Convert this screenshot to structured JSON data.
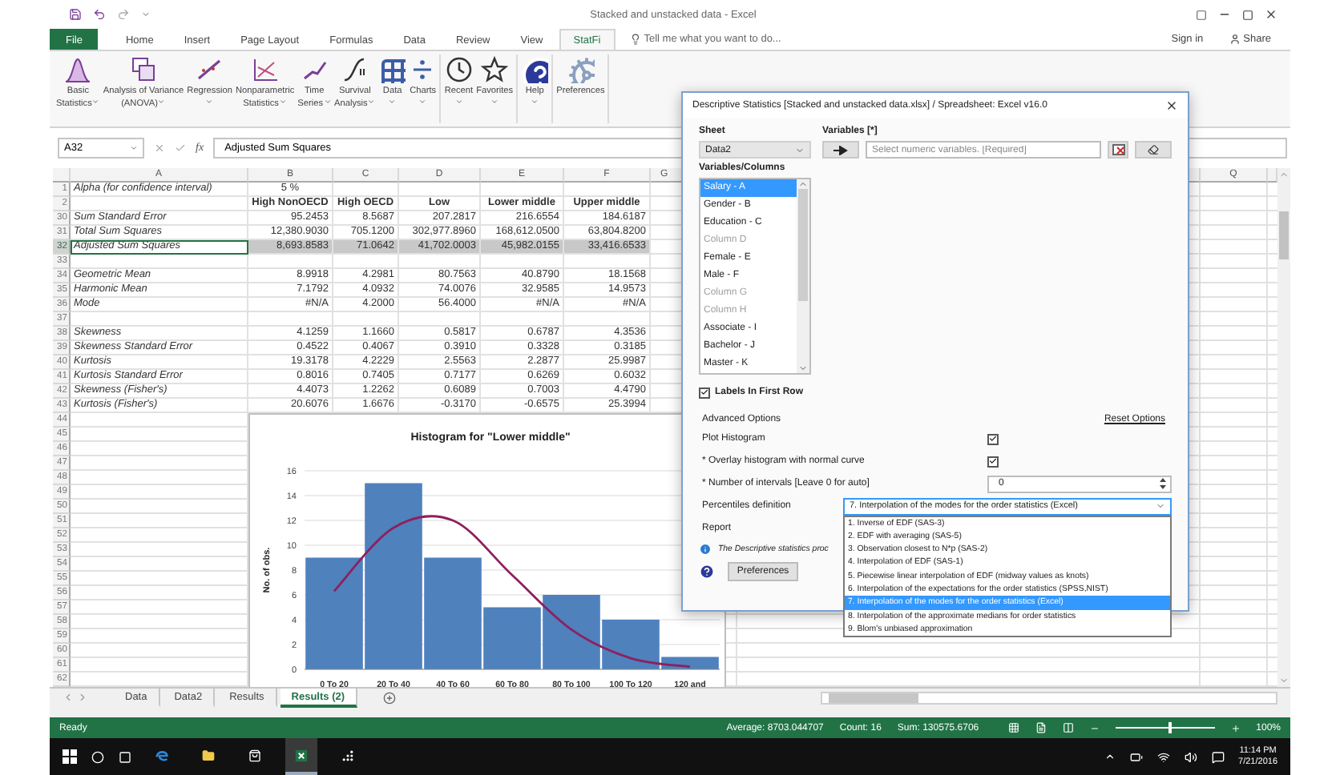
{
  "title_bar": {
    "title": "Stacked and unstacked data - Excel"
  },
  "menu_tabs": [
    {
      "label": "File",
      "kind": "file",
      "selected": false
    },
    {
      "label": "Home",
      "kind": "tab",
      "selected": false
    },
    {
      "label": "Insert",
      "kind": "tab",
      "selected": false
    },
    {
      "label": "Page Layout",
      "kind": "tab",
      "selected": false
    },
    {
      "label": "Formulas",
      "kind": "tab",
      "selected": false
    },
    {
      "label": "Data",
      "kind": "tab",
      "selected": false
    },
    {
      "label": "Review",
      "kind": "tab",
      "selected": false
    },
    {
      "label": "View",
      "kind": "tab",
      "selected": false
    },
    {
      "label": "StatFi",
      "kind": "tab",
      "selected": true
    }
  ],
  "tell_me": "Tell me what you want to do...",
  "account": {
    "sign_in": "Sign in",
    "share": "Share"
  },
  "ribbon": [
    {
      "buttons": [
        {
          "lines": [
            "Basic",
            "Statistics"
          ],
          "menu": true
        },
        {
          "lines": [
            "Analysis of Variance",
            "(ANOVA)"
          ],
          "menu": true
        },
        {
          "lines": [
            "Regression"
          ],
          "menu": true
        },
        {
          "lines": [
            "Nonparametric",
            "Statistics"
          ],
          "menu": true
        },
        {
          "lines": [
            "Time",
            "Series"
          ],
          "menu": true
        },
        {
          "lines": [
            "Survival",
            "Analysis"
          ],
          "menu": true
        },
        {
          "lines": [
            "Data"
          ],
          "menu": true
        },
        {
          "lines": [
            "Charts"
          ],
          "menu": true
        }
      ]
    },
    {
      "buttons": [
        {
          "lines": [
            "Recent"
          ],
          "menu": true
        },
        {
          "lines": [
            "Favorites"
          ],
          "menu": true
        }
      ]
    },
    {
      "buttons": [
        {
          "lines": [
            "Help"
          ],
          "menu": true
        }
      ]
    },
    {
      "buttons": [
        {
          "lines": [
            "Preferences"
          ],
          "menu": false
        }
      ]
    }
  ],
  "formula_bar": {
    "name_box": "A32",
    "function_label": "fx",
    "formula": "Adjusted Sum Squares"
  },
  "sheet": {
    "columns": [
      "A",
      "B",
      "C",
      "D",
      "E",
      "F",
      "G"
    ],
    "right_columns": [
      "Q"
    ],
    "rows": [
      {
        "num": "1",
        "kind": "param",
        "selected": false,
        "label": "Alpha (for confidence interval)",
        "values": [
          "5 %"
        ]
      },
      {
        "num": "2",
        "kind": "header",
        "selected": false,
        "values": [
          "High NonOECD",
          "High OECD",
          "Low",
          "Lower middle",
          "Upper middle"
        ]
      },
      {
        "num": "30",
        "kind": "stat",
        "selected": false,
        "label": "Sum Standard Error",
        "values": [
          "95.2453",
          "8.5687",
          "207.2817",
          "216.6554",
          "184.6187"
        ]
      },
      {
        "num": "31",
        "kind": "stat",
        "selected": false,
        "label": "Total Sum Squares",
        "values": [
          "12,380.9030",
          "705.1200",
          "302,977.8960",
          "168,612.0500",
          "63,804.8200"
        ]
      },
      {
        "num": "32",
        "kind": "stat",
        "selected": true,
        "label": "Adjusted Sum Squares",
        "values": [
          "8,693.8583",
          "71.0642",
          "41,702.0003",
          "45,982.0155",
          "33,416.6533"
        ]
      },
      {
        "num": "33",
        "kind": "blank",
        "selected": false
      },
      {
        "num": "34",
        "kind": "stat",
        "selected": false,
        "label": "Geometric Mean",
        "values": [
          "8.9918",
          "4.2981",
          "80.7563",
          "40.8790",
          "18.1568"
        ]
      },
      {
        "num": "35",
        "kind": "stat",
        "selected": false,
        "label": "Harmonic Mean",
        "values": [
          "7.1792",
          "4.0932",
          "74.0076",
          "32.9585",
          "14.9573"
        ]
      },
      {
        "num": "36",
        "kind": "stat",
        "selected": false,
        "label": "Mode",
        "values": [
          "#N/A",
          "4.2000",
          "56.4000",
          "#N/A",
          "#N/A"
        ]
      },
      {
        "num": "37",
        "kind": "blank",
        "selected": false
      },
      {
        "num": "38",
        "kind": "stat",
        "selected": false,
        "label": "Skewness",
        "values": [
          "4.1259",
          "1.1660",
          "0.5817",
          "0.6787",
          "4.3536"
        ]
      },
      {
        "num": "39",
        "kind": "stat",
        "selected": false,
        "label": "Skewness Standard Error",
        "values": [
          "0.4522",
          "0.4067",
          "0.3910",
          "0.3328",
          "0.3185"
        ]
      },
      {
        "num": "40",
        "kind": "stat",
        "selected": false,
        "label": "Kurtosis",
        "values": [
          "19.3178",
          "4.2229",
          "2.5563",
          "2.2877",
          "25.9987"
        ]
      },
      {
        "num": "41",
        "kind": "stat",
        "selected": false,
        "label": "Kurtosis Standard Error",
        "values": [
          "0.8016",
          "0.7405",
          "0.7177",
          "0.6269",
          "0.6032"
        ]
      },
      {
        "num": "42",
        "kind": "stat",
        "selected": false,
        "label": "Skewness (Fisher's)",
        "values": [
          "4.4073",
          "1.2262",
          "0.6089",
          "0.7003",
          "4.4790"
        ]
      },
      {
        "num": "43",
        "kind": "stat",
        "selected": false,
        "label": "Kurtosis (Fisher's)",
        "values": [
          "20.6076",
          "1.6676",
          "-0.3170",
          "-0.6575",
          "25.3994"
        ]
      },
      {
        "num": "44",
        "kind": "blank",
        "selected": false
      },
      {
        "num": "45",
        "kind": "blank",
        "selected": false
      },
      {
        "num": "46",
        "kind": "blank",
        "selected": false
      },
      {
        "num": "47",
        "kind": "blank",
        "selected": false
      },
      {
        "num": "48",
        "kind": "blank",
        "selected": false
      },
      {
        "num": "49",
        "kind": "blank",
        "selected": false
      },
      {
        "num": "50",
        "kind": "blank",
        "selected": false
      },
      {
        "num": "51",
        "kind": "blank",
        "selected": false
      },
      {
        "num": "52",
        "kind": "blank",
        "selected": false
      },
      {
        "num": "53",
        "kind": "blank",
        "selected": false
      },
      {
        "num": "54",
        "kind": "blank",
        "selected": false
      },
      {
        "num": "55",
        "kind": "blank",
        "selected": false
      },
      {
        "num": "56",
        "kind": "blank",
        "selected": false
      },
      {
        "num": "57",
        "kind": "blank",
        "selected": false
      },
      {
        "num": "58",
        "kind": "blank",
        "selected": false
      },
      {
        "num": "59",
        "kind": "blank",
        "selected": false
      },
      {
        "num": "60",
        "kind": "blank",
        "selected": false
      },
      {
        "num": "61",
        "kind": "blank",
        "selected": false
      },
      {
        "num": "62",
        "kind": "blank",
        "selected": false
      }
    ],
    "chart": {
      "chart_data": {
        "type": "bar",
        "title": "Histogram for \"Lower middle\"",
        "ylabel": "No. of obs.",
        "categories": [
          "0 To 20",
          "20 To 40",
          "40 To 60",
          "60 To 80",
          "80 To 100",
          "100 To 120",
          "120 and"
        ],
        "series": [
          {
            "color": "#4f81bd",
            "values": [
              9,
              15,
              9,
              5,
              6,
              4,
              1
            ]
          },
          {
            "type": "line",
            "color": "#8e1f5e",
            "values": [
              6.3,
              11.4,
              12.0,
              7.6,
              3.2,
              0.9,
              0.2
            ]
          }
        ],
        "ylim": [
          0,
          16
        ],
        "grid": true,
        "yticks": [
          0,
          2,
          4,
          6,
          8,
          10,
          12,
          14,
          16
        ]
      }
    }
  },
  "sheet_tabs": [
    {
      "label": "Data",
      "selected": false
    },
    {
      "label": "Data2",
      "selected": false
    },
    {
      "label": "Results",
      "selected": false
    },
    {
      "label": "Results (2)",
      "selected": true
    }
  ],
  "status_bar": {
    "state": "Ready",
    "average": "Average: 8703.044707",
    "count": "Count: 16",
    "sum": "Sum: 130575.6706",
    "zoom": {
      "level": 0.55
    },
    "zoom_label": "100%"
  },
  "dialog": {
    "title": "Descriptive Statistics [Stacked and unstacked data.xlsx] / Spreadsheet: Excel v16.0",
    "sheet_label": "Sheet",
    "sheet_value": "Data2",
    "variables_label": "Variables [*]",
    "variables_placeholder": "Select numeric variables. [Required]",
    "columns_label": "Variables/Columns",
    "columns": [
      {
        "label": "Salary - A",
        "selected": true,
        "disabled": false
      },
      {
        "label": "Gender - B",
        "selected": false,
        "disabled": false
      },
      {
        "label": "Education - C",
        "selected": false,
        "disabled": false
      },
      {
        "label": "Column D",
        "selected": false,
        "disabled": true
      },
      {
        "label": "Female - E",
        "selected": false,
        "disabled": false
      },
      {
        "label": "Male - F",
        "selected": false,
        "disabled": false
      },
      {
        "label": "Column G",
        "selected": false,
        "disabled": true
      },
      {
        "label": "Column H",
        "selected": false,
        "disabled": true
      },
      {
        "label": "Associate - I",
        "selected": false,
        "disabled": false
      },
      {
        "label": "Bachelor - J",
        "selected": false,
        "disabled": false
      },
      {
        "label": "Master - K",
        "selected": false,
        "disabled": false
      }
    ],
    "labels_first_row": {
      "label": "Labels In First Row",
      "checked": true
    },
    "advanced_label": "Advanced Options",
    "reset_link": "Reset Options",
    "options": [
      {
        "kind": "checkbox",
        "label": "Plot Histogram",
        "checked": true
      },
      {
        "kind": "checkbox",
        "label": "* Overlay histogram with normal curve",
        "checked": true
      },
      {
        "kind": "spinner",
        "label": "* Number of intervals [Leave 0 for auto]",
        "value": "0"
      },
      {
        "kind": "select",
        "label": "Percentiles definition",
        "value": "7. Interpolation of the modes for the order statistics (Excel)",
        "expanded": true,
        "options": [
          {
            "label": "1. Inverse of EDF (SAS-3)",
            "selected": false
          },
          {
            "label": "2. EDF with averaging (SAS-5)",
            "selected": false
          },
          {
            "label": "3. Observation closest to N*p (SAS-2)",
            "selected": false
          },
          {
            "label": "4. Interpolation of EDF (SAS-1)",
            "selected": false
          },
          {
            "label": "5. Piecewise linear interpolation of EDF (midway values as knots)",
            "selected": false
          },
          {
            "label": "6. Interpolation of the expectations for the order statistics (SPSS,NIST)",
            "selected": false
          },
          {
            "label": "7. Interpolation of the modes for the order statistics (Excel)",
            "selected": true
          },
          {
            "label": "8. Interpolation of the approximate medians for order statistics",
            "selected": false
          },
          {
            "label": "9. Blom's unbiased approximation",
            "selected": false
          }
        ]
      },
      {
        "kind": "select",
        "label": "Report"
      }
    ],
    "info": "The Descriptive statistics proc",
    "buttons": [
      "Preferences"
    ]
  },
  "taskbar": {
    "apps": [
      {
        "selected": false
      },
      {
        "selected": false
      },
      {
        "selected": false
      },
      {
        "selected": true
      },
      {
        "selected": false
      }
    ],
    "time": "11:14 PM",
    "date": "7/21/2016"
  }
}
